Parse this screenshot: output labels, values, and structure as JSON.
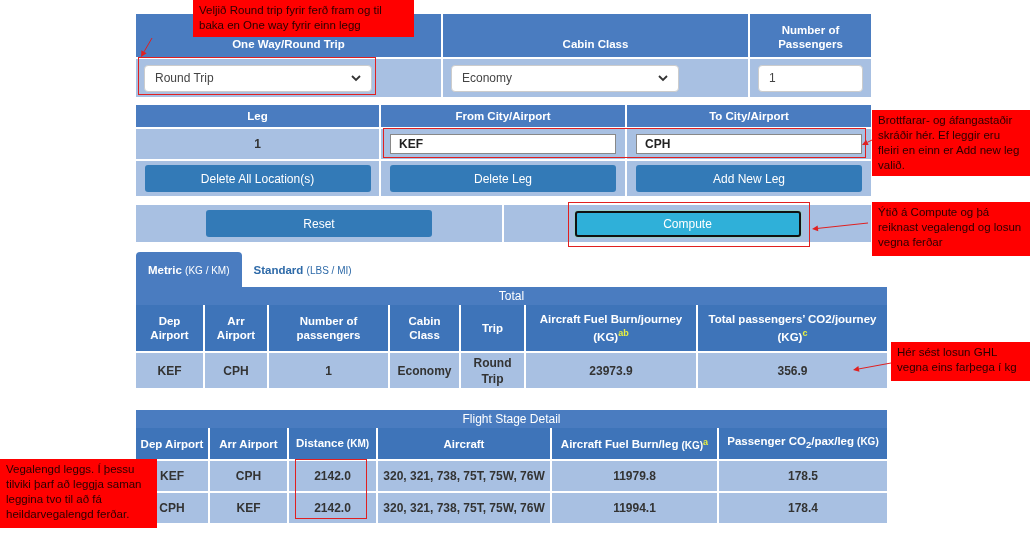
{
  "trip_form": {
    "columns": [
      "One Way/Round Trip",
      "Cabin Class",
      "Number of Passengers"
    ],
    "trip_type": "Round Trip",
    "cabin_class": "Economy",
    "passengers": "1"
  },
  "legs": {
    "columns": [
      "Leg",
      "From City/Airport",
      "To City/Airport"
    ],
    "rows": [
      {
        "leg": "1",
        "from": "KEF",
        "to": "CPH"
      }
    ],
    "buttons": [
      "Delete All Location(s)",
      "Delete Leg",
      "Add New Leg"
    ]
  },
  "actions": [
    {
      "label": "Reset",
      "kind": "normal"
    },
    {
      "label": "Compute",
      "kind": "primary"
    }
  ],
  "unit_tabs": [
    {
      "label": "Metric",
      "unit": "(KG / KM)",
      "selected": true
    },
    {
      "label": "Standard",
      "unit": "(LBS / MI)",
      "selected": false
    }
  ],
  "total": {
    "title": "Total",
    "columns": [
      "Dep Airport",
      "Arr Airport",
      "Number of passengers",
      "Cabin Class",
      "Trip",
      "Aircraft Fuel Burn/journey (KG)$^{ab}$",
      "Total passengers’ CO2/journey (KG)$^{c}$"
    ],
    "rows": [
      [
        "KEF",
        "CPH",
        "1",
        "Economy",
        "Round Trip",
        "23973.9",
        "356.9"
      ]
    ]
  },
  "flight_stage": {
    "title": "Flight Stage Detail",
    "columns": [
      {
        "label": "Dep Airport"
      },
      {
        "label": "Arr Airport"
      },
      {
        "label": "Distance",
        "unit": "(KM)"
      },
      {
        "label": "Aircraft"
      },
      {
        "label": "Aircraft Fuel Burn/leg",
        "unit": "(KG)$^{a}$"
      },
      {
        "label": "Passenger CO$_{2}$/pax/leg",
        "unit": "(KG)"
      }
    ],
    "rows": [
      [
        "KEF",
        "CPH",
        "2142.0",
        "320, 321, 738, 75T, 75W, 76W",
        "11979.8",
        "178.5"
      ],
      [
        "CPH",
        "KEF",
        "2142.0",
        "320, 321, 738, 75T, 75W, 76W",
        "11994.1",
        "178.4"
      ]
    ]
  },
  "annotations": [
    {
      "text": "Veljið Round trip fyrir ferð fram og til baka en One way fyrir einn legg"
    },
    {
      "text": "Brottfarar- og áfangastaðir skráðir hér. Ef leggir eru fleiri en einn er Add new leg valið."
    },
    {
      "text": "Ýtið á Compute og þá reiknast vegalengd og losun vegna ferðar"
    },
    {
      "text": "Hér sést losun GHL vegna eins farþega í kg"
    },
    {
      "text": "Vegalengd leggs. Í þessu tilviki þarf að leggja saman leggina tvo til að fá heildarvegalengd ferðar."
    }
  ]
}
